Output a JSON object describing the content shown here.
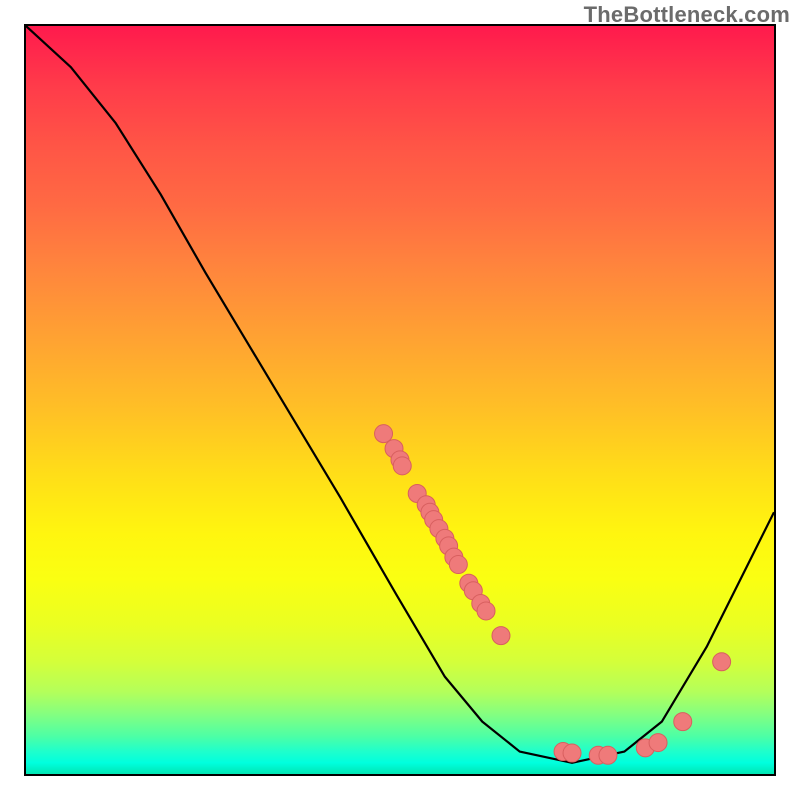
{
  "watermark": "TheBottleneck.com",
  "chart_data": {
    "type": "line",
    "title": "",
    "xlabel": "",
    "ylabel": "",
    "xlim": [
      0,
      100
    ],
    "ylim": [
      0,
      100
    ],
    "grid": false,
    "curve": [
      {
        "xr": 0.0,
        "yr": 0.0
      },
      {
        "xr": 0.06,
        "yr": 0.055
      },
      {
        "xr": 0.12,
        "yr": 0.13
      },
      {
        "xr": 0.18,
        "yr": 0.225
      },
      {
        "xr": 0.24,
        "yr": 0.33
      },
      {
        "xr": 0.3,
        "yr": 0.43
      },
      {
        "xr": 0.36,
        "yr": 0.53
      },
      {
        "xr": 0.42,
        "yr": 0.63
      },
      {
        "xr": 0.495,
        "yr": 0.76
      },
      {
        "xr": 0.56,
        "yr": 0.87
      },
      {
        "xr": 0.61,
        "yr": 0.93
      },
      {
        "xr": 0.66,
        "yr": 0.97
      },
      {
        "xr": 0.73,
        "yr": 0.985
      },
      {
        "xr": 0.8,
        "yr": 0.97
      },
      {
        "xr": 0.85,
        "yr": 0.93
      },
      {
        "xr": 0.91,
        "yr": 0.83
      },
      {
        "xr": 0.97,
        "yr": 0.71
      },
      {
        "xr": 1.0,
        "yr": 0.65
      }
    ],
    "points": [
      {
        "xr": 0.478,
        "yr": 0.545
      },
      {
        "xr": 0.492,
        "yr": 0.565
      },
      {
        "xr": 0.5,
        "yr": 0.58
      },
      {
        "xr": 0.503,
        "yr": 0.588
      },
      {
        "xr": 0.523,
        "yr": 0.625
      },
      {
        "xr": 0.535,
        "yr": 0.64
      },
      {
        "xr": 0.54,
        "yr": 0.65
      },
      {
        "xr": 0.545,
        "yr": 0.66
      },
      {
        "xr": 0.552,
        "yr": 0.672
      },
      {
        "xr": 0.56,
        "yr": 0.685
      },
      {
        "xr": 0.565,
        "yr": 0.695
      },
      {
        "xr": 0.572,
        "yr": 0.71
      },
      {
        "xr": 0.578,
        "yr": 0.72
      },
      {
        "xr": 0.592,
        "yr": 0.745
      },
      {
        "xr": 0.598,
        "yr": 0.755
      },
      {
        "xr": 0.608,
        "yr": 0.772
      },
      {
        "xr": 0.615,
        "yr": 0.782
      },
      {
        "xr": 0.635,
        "yr": 0.815
      },
      {
        "xr": 0.718,
        "yr": 0.97
      },
      {
        "xr": 0.73,
        "yr": 0.972
      },
      {
        "xr": 0.765,
        "yr": 0.975
      },
      {
        "xr": 0.778,
        "yr": 0.975
      },
      {
        "xr": 0.828,
        "yr": 0.965
      },
      {
        "xr": 0.845,
        "yr": 0.958
      },
      {
        "xr": 0.878,
        "yr": 0.93
      },
      {
        "xr": 0.93,
        "yr": 0.85
      }
    ],
    "point_color": "#ef7a7a",
    "point_stroke": "#d85f5f",
    "point_radius_px": 9
  }
}
